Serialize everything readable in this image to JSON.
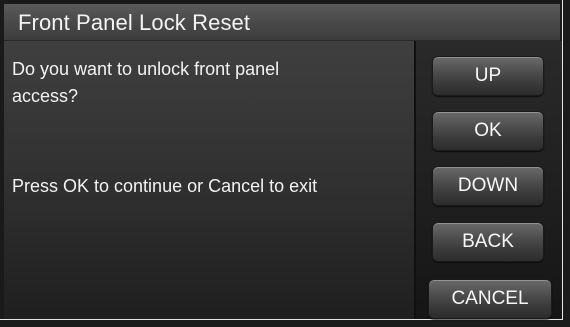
{
  "title_bar": {
    "title": "Front Panel Lock Reset"
  },
  "message": {
    "question_line1": "Do you want to unlock front panel",
    "question_line2": "access?",
    "instruction": "Press OK to continue or Cancel to exit"
  },
  "buttons": {
    "up": "UP",
    "ok": "OK",
    "down": "DOWN",
    "back": "BACK",
    "cancel": "CANCEL"
  },
  "colors": {
    "background": "#1b1b1b",
    "title_bar": "#4b4b4b",
    "text": "#f2f2f2",
    "button": "#505050"
  }
}
